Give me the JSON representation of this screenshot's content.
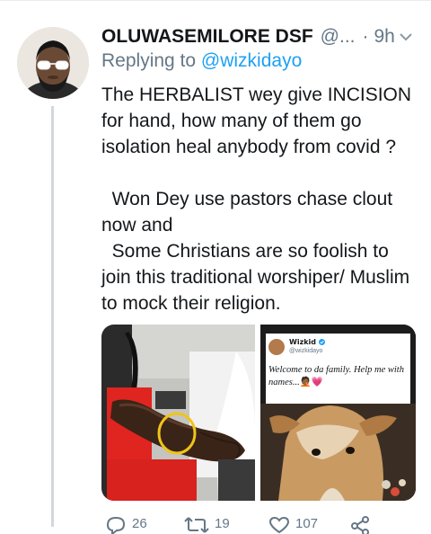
{
  "tweet": {
    "display_name": "OLUWASEMILORE DSF",
    "handle": "@...",
    "time_separator": "·",
    "time": "9h",
    "reply_prefix": "Replying to",
    "reply_to": "@wizkidayo",
    "paragraphs": [
      "The HERBALIST wey give INCISION for hand, how many of them go isolation heal anybody from covid ?",
      "  Won Dey use pastors chase clout now and\n  Some Christians are so foolish to join this traditional worshiper/ Muslim to mock their religion."
    ]
  },
  "media": {
    "embedded_tweet": {
      "name": "Wizkid",
      "handle": "@wizkidayo",
      "text": "Welcome to da family. Help me with names...",
      "emojis": "🤦🏾💗"
    }
  },
  "actions": {
    "reply_count": "26",
    "retweet_count": "19",
    "like_count": "107"
  },
  "colors": {
    "link": "#1da1f2",
    "secondary_text": "#657786",
    "verified": "#1da1f2"
  },
  "icons": [
    "chevron-down-icon",
    "verified-badge-icon",
    "reply-icon",
    "retweet-icon",
    "like-icon",
    "share-icon"
  ]
}
